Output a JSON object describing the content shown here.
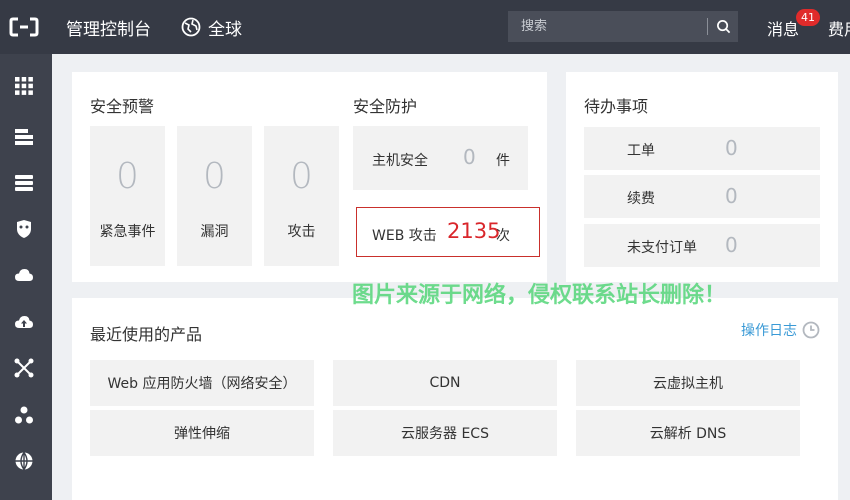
{
  "header": {
    "title": "管理控制台",
    "region": "全球",
    "search_placeholder": "搜索",
    "messages_label": "消息",
    "messages_count": "41",
    "fees_label": "费用"
  },
  "sidebar": {
    "icons": [
      "grid-icon",
      "storage-icon",
      "server-icon",
      "shield-icon",
      "cloud-icon",
      "cloud-upload-icon",
      "network-icon",
      "cluster-icon",
      "globe-icon"
    ]
  },
  "security_alert": {
    "title": "安全预警",
    "items": [
      {
        "value": "0",
        "label": "紧急事件"
      },
      {
        "value": "0",
        "label": "漏洞"
      },
      {
        "value": "0",
        "label": "攻击"
      }
    ]
  },
  "security_protection": {
    "title": "安全防护",
    "host": {
      "label": "主机安全",
      "value": "0",
      "unit": "件"
    },
    "web": {
      "label": "WEB 攻击",
      "value": "2135",
      "unit": "次"
    }
  },
  "todo": {
    "title": "待办事项",
    "rows": [
      {
        "label": "工单",
        "value": "0"
      },
      {
        "label": "续费",
        "value": "0"
      },
      {
        "label": "未支付订单",
        "value": "0"
      }
    ]
  },
  "watermark": "图片来源于网络，侵权联系站长删除！",
  "recent": {
    "title": "最近使用的产品",
    "log_link": "操作日志",
    "products": [
      "Web 应用防火墙（网络安全）",
      "CDN",
      "云虚拟主机",
      "弹性伸缩",
      "云服务器 ECS",
      "云解析 DNS"
    ]
  },
  "colors": {
    "topbar": "#363a45",
    "sidebar": "#3e424d",
    "accent_red": "#d9262b",
    "link_blue": "#3a9ad6"
  }
}
